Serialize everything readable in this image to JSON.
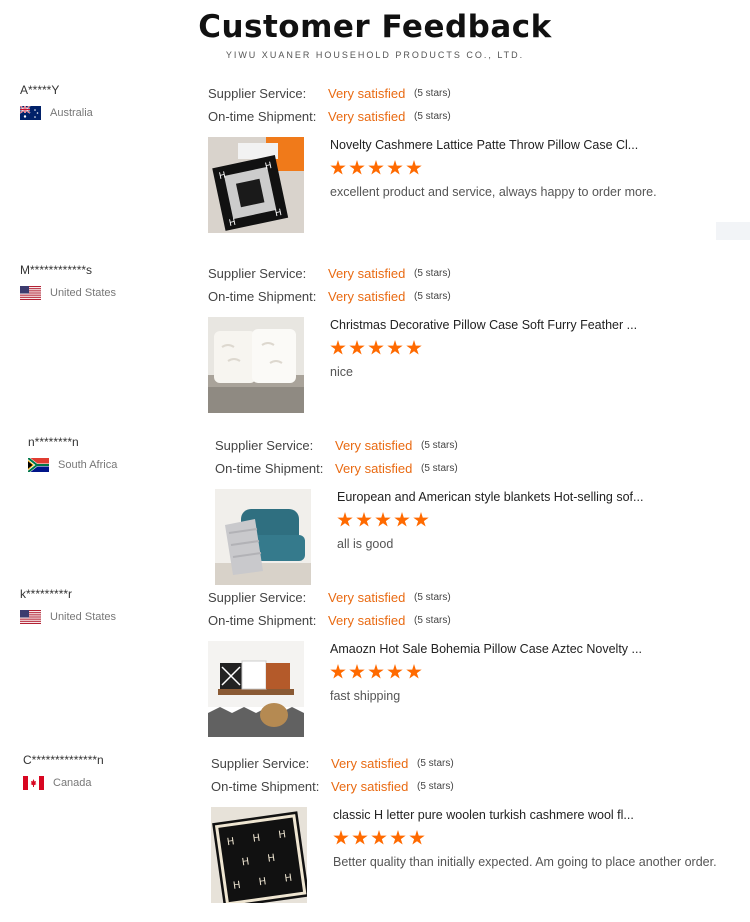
{
  "page": {
    "title": "Customer Feedback",
    "subtitle": "YIWU XUANER HOUSEHOLD PRODUCTS CO., LTD."
  },
  "colors": {
    "accent": "#e96a12",
    "star": "#ff6a00"
  },
  "reviews": [
    {
      "buyer": "A*****Y",
      "country": "Australia",
      "flag": "australia-flag-icon",
      "supplier_label": "Supplier Service:",
      "supplier_value": "Very satisfied",
      "supplier_stars": "(5 stars)",
      "shipment_label": "On-time Shipment:",
      "shipment_value": "Very satisfied",
      "shipment_stars": "(5 stars)",
      "product": "Novelty Cashmere Lattice Patte Throw Pillow Case Cl...",
      "rating": 5,
      "comment": "excellent product and service, always happy to order more."
    },
    {
      "buyer": "M************s",
      "country": "United States",
      "flag": "usa-flag-icon",
      "supplier_label": "Supplier Service:",
      "supplier_value": "Very satisfied",
      "supplier_stars": "(5 stars)",
      "shipment_label": "On-time Shipment:",
      "shipment_value": "Very satisfied",
      "shipment_stars": "(5 stars)",
      "product": "Christmas Decorative Pillow Case Soft Furry Feather ...",
      "rating": 5,
      "comment": "nice"
    },
    {
      "buyer": "n********n",
      "country": "South Africa",
      "flag": "south-africa-flag-icon",
      "supplier_label": "Supplier Service:",
      "supplier_value": "Very satisfied",
      "supplier_stars": "(5 stars)",
      "shipment_label": "On-time Shipment:",
      "shipment_value": "Very satisfied",
      "shipment_stars": "(5 stars)",
      "product": "European and American style blankets Hot-selling sof...",
      "rating": 5,
      "comment": "all is good"
    },
    {
      "buyer": "k*********r",
      "country": "United States",
      "flag": "usa-flag-icon",
      "supplier_label": "Supplier Service:",
      "supplier_value": "Very satisfied",
      "supplier_stars": "(5 stars)",
      "shipment_label": "On-time Shipment:",
      "shipment_value": "Very satisfied",
      "shipment_stars": "(5 stars)",
      "product": "Amaozn Hot Sale Bohemia Pillow Case Aztec Novelty ...",
      "rating": 5,
      "comment": "fast shipping"
    },
    {
      "buyer": "C**************n",
      "country": "Canada",
      "flag": "canada-flag-icon",
      "supplier_label": "Supplier Service:",
      "supplier_value": "Very satisfied",
      "supplier_stars": "(5 stars)",
      "shipment_label": "On-time Shipment:",
      "shipment_value": "Very satisfied",
      "shipment_stars": "(5 stars)",
      "product": "classic H letter pure woolen turkish cashmere wool fl...",
      "rating": 5,
      "comment": "Better quality than initially expected. Am going to place another order."
    }
  ]
}
